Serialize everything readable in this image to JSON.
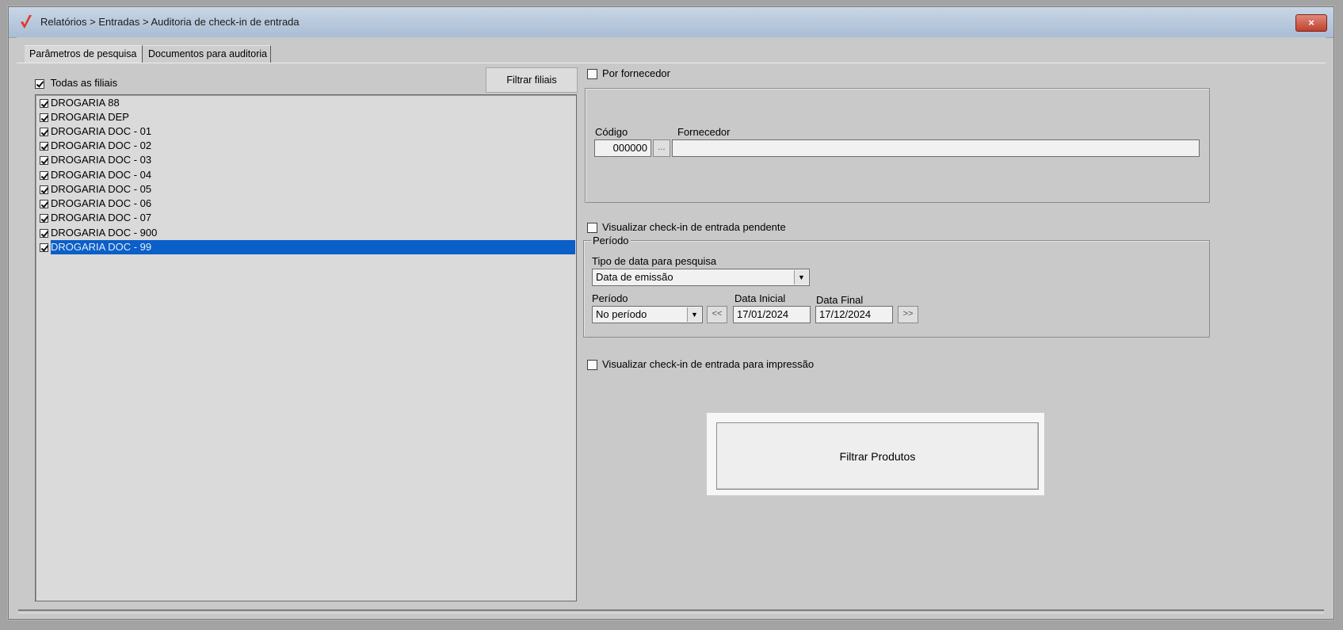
{
  "window": {
    "title": "Relatórios > Entradas > Auditoria de check-in de entrada",
    "close_glyph": "×"
  },
  "tabs": [
    {
      "label": "Parâmetros de pesquisa",
      "active": true
    },
    {
      "label": "Documentos para auditoria",
      "active": false
    }
  ],
  "filiais": {
    "all_label": "Todas as filiais",
    "all_checked": true,
    "filter_button": "Filtrar filiais",
    "items": [
      {
        "label": "DROGARIA 88",
        "checked": true
      },
      {
        "label": "DROGARIA DEP",
        "checked": true
      },
      {
        "label": "DROGARIA DOC - 01",
        "checked": true
      },
      {
        "label": "DROGARIA DOC - 02",
        "checked": true
      },
      {
        "label": "DROGARIA DOC - 03",
        "checked": true
      },
      {
        "label": "DROGARIA DOC - 04",
        "checked": true
      },
      {
        "label": "DROGARIA DOC - 05",
        "checked": true
      },
      {
        "label": "DROGARIA DOC - 06",
        "checked": true
      },
      {
        "label": "DROGARIA DOC - 07",
        "checked": true
      },
      {
        "label": "DROGARIA DOC - 900",
        "checked": true
      },
      {
        "label": "DROGARIA DOC - 99",
        "checked": true,
        "selected": true
      }
    ]
  },
  "fornecedor": {
    "checkbox_label": "Por fornecedor",
    "checked": false,
    "codigo_label": "Código",
    "codigo_value": "000000",
    "lookup_button": "...",
    "fornecedor_label": "Fornecedor",
    "fornecedor_value": ""
  },
  "pendente": {
    "label": "Visualizar check-in de entrada pendente",
    "checked": false
  },
  "periodo": {
    "legend": "Período",
    "tipo_data_label": "Tipo de data para pesquisa",
    "tipo_data_value": "Data de emissão",
    "periodo_label": "Período",
    "periodo_value": "No período",
    "prev_button": "<<",
    "data_inicial_label": "Data Inicial",
    "data_inicial_value": "17/01/2024",
    "data_final_label": "Data Final",
    "data_final_value": "17/12/2024",
    "next_button": ">>"
  },
  "impressao": {
    "label": "Visualizar check-in de entrada para impressão",
    "checked": false
  },
  "filtrar_produtos": "Filtrar Produtos",
  "colors": {
    "title_bar": "#b9cadd",
    "selection": "#0a5fc8",
    "close": "#c0402e",
    "logo": "#e0362a"
  }
}
